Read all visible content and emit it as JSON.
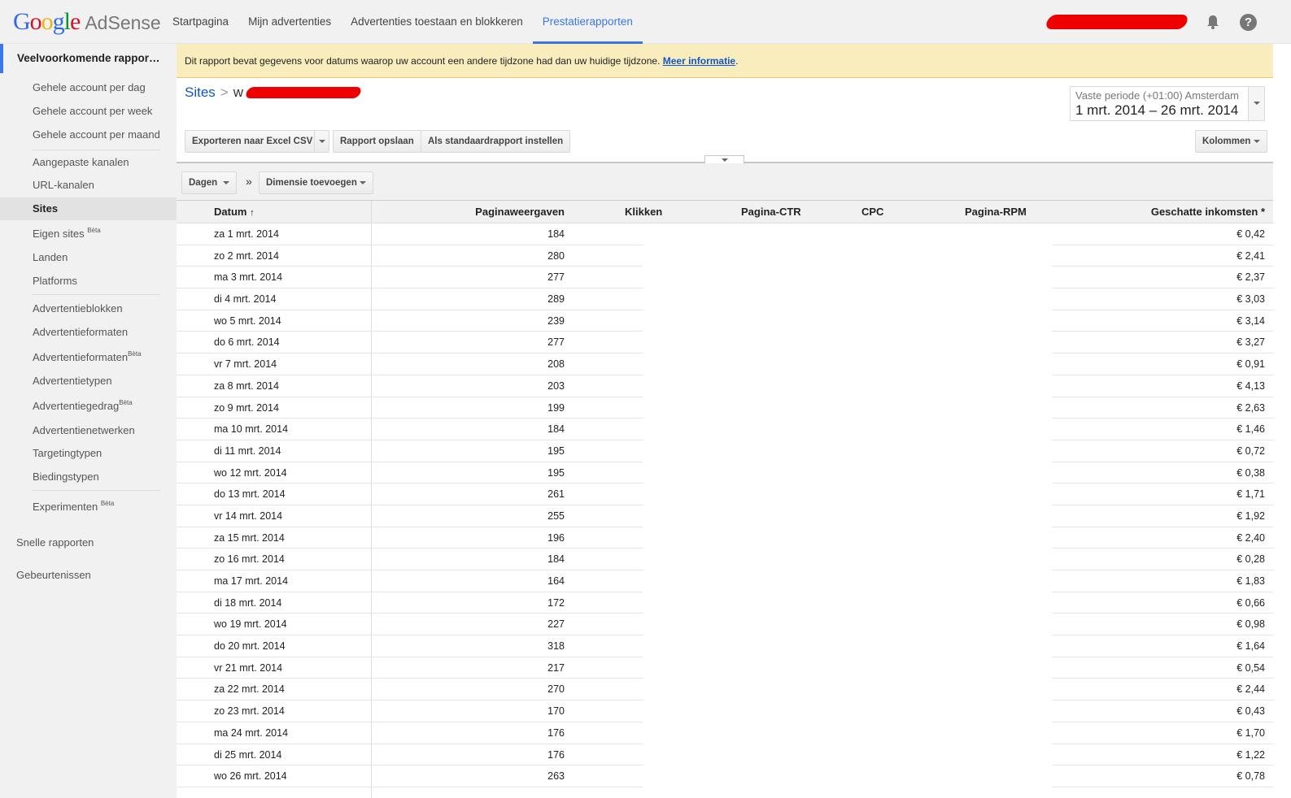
{
  "nav": [
    "Startpagina",
    "Mijn advertenties",
    "Advertenties toestaan en blokkeren",
    "Prestatierapporten"
  ],
  "brand": {
    "product": "AdSense"
  },
  "sidebar": {
    "header": "Veelvoorkomende rappor…",
    "items": [
      "Gehele account per dag",
      "Gehele account per week",
      "Gehele account per maand",
      "Aangepaste kanalen",
      "URL-kanalen",
      "Sites",
      "Eigen sites",
      "Landen",
      "Platforms",
      "Advertentieblokken",
      "Advertentieformaten",
      "Advertentieformaten",
      "Advertentietypen",
      "Advertentiegedrag",
      "Advertentienetwerken",
      "Targetingtypen",
      "Biedingstypen",
      "Experimenten"
    ],
    "beta": "Bèta",
    "snelle": "Snelle rapporten",
    "gebeurtenissen": "Gebeurtenissen"
  },
  "notice": {
    "text": "Dit rapport bevat gegevens voor datums waarop uw account een andere tijdzone had dan uw huidige tijdzone.",
    "link": "Meer informatie",
    "period": "."
  },
  "breadcrumb": {
    "root": "Sites",
    "sep": ">",
    "prefix": "w"
  },
  "date_range": {
    "label": "Vaste periode (+01:00) Amsterdam",
    "range": "1 mrt. 2014 – 26 mrt. 2014"
  },
  "toolbar": {
    "export": "Exporteren naar Excel CSV",
    "save": "Rapport opslaan",
    "default": "Als standaardrapport instellen",
    "columns": "Kolommen"
  },
  "dims": {
    "days": "Dagen",
    "sep": "»",
    "add": "Dimensie toevoegen"
  },
  "columns": {
    "date": "Datum",
    "pv": "Paginaweergaven",
    "clicks": "Klikken",
    "ctr": "Pagina-CTR",
    "cpc": "CPC",
    "rpm": "Pagina-RPM",
    "income": "Geschatte inkomsten *"
  },
  "rows": [
    [
      "za 1 mrt. 2014",
      "184",
      "€ 0,42"
    ],
    [
      "zo 2 mrt. 2014",
      "280",
      "€ 2,41"
    ],
    [
      "ma 3 mrt. 2014",
      "277",
      "€ 2,37"
    ],
    [
      "di 4 mrt. 2014",
      "289",
      "€ 3,03"
    ],
    [
      "wo 5 mrt. 2014",
      "239",
      "€ 3,14"
    ],
    [
      "do 6 mrt. 2014",
      "277",
      "€ 3,27"
    ],
    [
      "vr 7 mrt. 2014",
      "208",
      "€ 0,91"
    ],
    [
      "za 8 mrt. 2014",
      "203",
      "€ 4,13"
    ],
    [
      "zo 9 mrt. 2014",
      "199",
      "€ 2,63"
    ],
    [
      "ma 10 mrt. 2014",
      "184",
      "€ 1,46"
    ],
    [
      "di 11 mrt. 2014",
      "195",
      "€ 0,72"
    ],
    [
      "wo 12 mrt. 2014",
      "195",
      "€ 0,38"
    ],
    [
      "do 13 mrt. 2014",
      "261",
      "€ 1,71"
    ],
    [
      "vr 14 mrt. 2014",
      "255",
      "€ 1,92"
    ],
    [
      "za 15 mrt. 2014",
      "196",
      "€ 2,40"
    ],
    [
      "zo 16 mrt. 2014",
      "184",
      "€ 0,28"
    ],
    [
      "ma 17 mrt. 2014",
      "164",
      "€ 1,83"
    ],
    [
      "di 18 mrt. 2014",
      "172",
      "€ 0,66"
    ],
    [
      "wo 19 mrt. 2014",
      "227",
      "€ 0,98"
    ],
    [
      "do 20 mrt. 2014",
      "318",
      "€ 1,64"
    ],
    [
      "vr 21 mrt. 2014",
      "217",
      "€ 0,54"
    ],
    [
      "za 22 mrt. 2014",
      "270",
      "€ 2,44"
    ],
    [
      "zo 23 mrt. 2014",
      "170",
      "€ 0,43"
    ],
    [
      "ma 24 mrt. 2014",
      "176",
      "€ 1,70"
    ],
    [
      "di 25 mrt. 2014",
      "176",
      "€ 1,22"
    ],
    [
      "wo 26 mrt. 2014",
      "263",
      "€ 0,78"
    ]
  ],
  "colors": {
    "accent": "#3b78e7",
    "notice_bg": "#f9edbe",
    "redaction": "#e00000"
  }
}
